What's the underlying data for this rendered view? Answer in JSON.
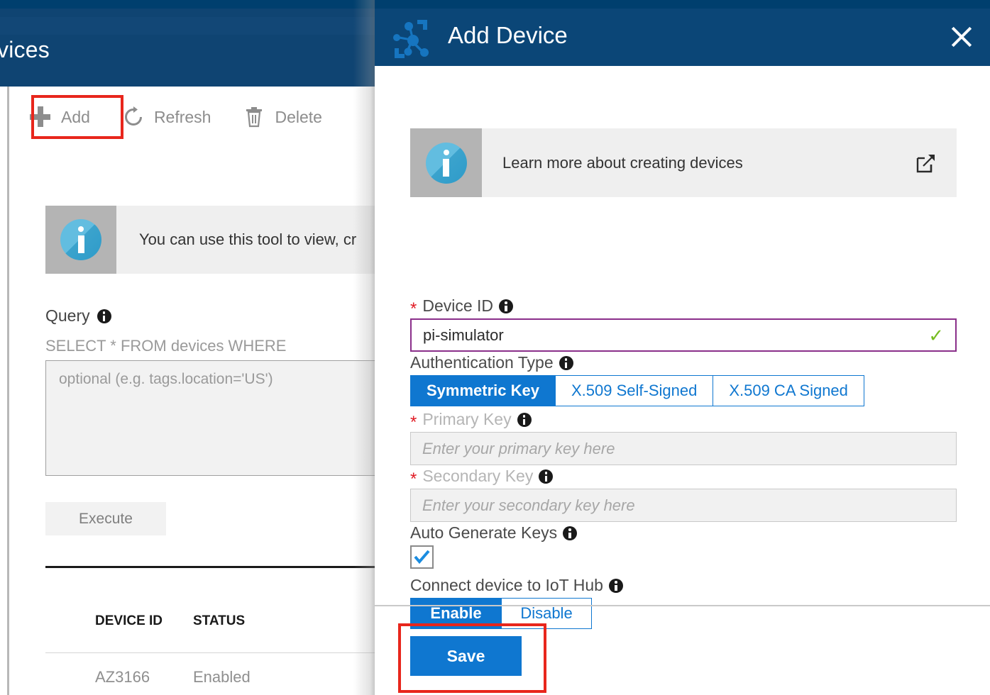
{
  "background": {
    "page_title": "evices",
    "toolbar": [
      {
        "label": "Add",
        "icon": "plus-icon"
      },
      {
        "label": "Refresh",
        "icon": "refresh-icon"
      },
      {
        "label": "Delete",
        "icon": "trash-icon"
      }
    ],
    "info_banner": {
      "icon": "info-icon",
      "text": "You can use this tool to view, cr"
    },
    "query": {
      "label": "Query",
      "info_icon": "info-icon",
      "prefix": "SELECT * FROM devices WHERE",
      "placeholder": "optional (e.g. tags.location='US')",
      "execute_label": "Execute"
    },
    "table": {
      "columns": [
        "DEVICE ID",
        "STATUS"
      ],
      "rows": [
        {
          "device_id": "AZ3166",
          "status": "Enabled"
        }
      ]
    }
  },
  "panel": {
    "title": "Add Device",
    "icon": "iot-hub-icon",
    "close_icon": "close-icon",
    "learn_banner": {
      "icon": "info-icon",
      "text": "Learn more about creating devices",
      "external_link_icon": "external-link-icon"
    },
    "device_id": {
      "label": "Device ID",
      "required": "*",
      "info_icon": "info-icon",
      "value": "pi-simulator",
      "valid_icon": "✓"
    },
    "auth_type": {
      "label": "Authentication Type",
      "info_icon": "info-icon",
      "options": [
        "Symmetric Key",
        "X.509 Self-Signed",
        "X.509 CA Signed"
      ],
      "selected": "Symmetric Key"
    },
    "primary_key": {
      "label": "Primary Key",
      "required": "*",
      "info_icon": "info-icon",
      "value": "",
      "placeholder": "Enter your primary key here",
      "disabled": true
    },
    "secondary_key": {
      "label": "Secondary Key",
      "required": "*",
      "info_icon": "info-icon",
      "value": "",
      "placeholder": "Enter your secondary key here",
      "disabled": true
    },
    "auto_generate_keys": {
      "label": "Auto Generate Keys",
      "info_icon": "info-icon",
      "checked": true
    },
    "connect_device": {
      "label": "Connect device to IoT Hub",
      "info_icon": "info-icon",
      "options": [
        "Enable",
        "Disable"
      ],
      "selected": "Enable"
    },
    "save_label": "Save"
  },
  "colors": {
    "azure_header": "#0f4472",
    "panel_header": "#0b4677",
    "accent_blue": "#0f77d0",
    "highlight_red": "#e8261c",
    "input_focus_purple": "#8a2f8a",
    "valid_green": "#76bc21",
    "info_icon_blue": "#3ba3cd"
  }
}
